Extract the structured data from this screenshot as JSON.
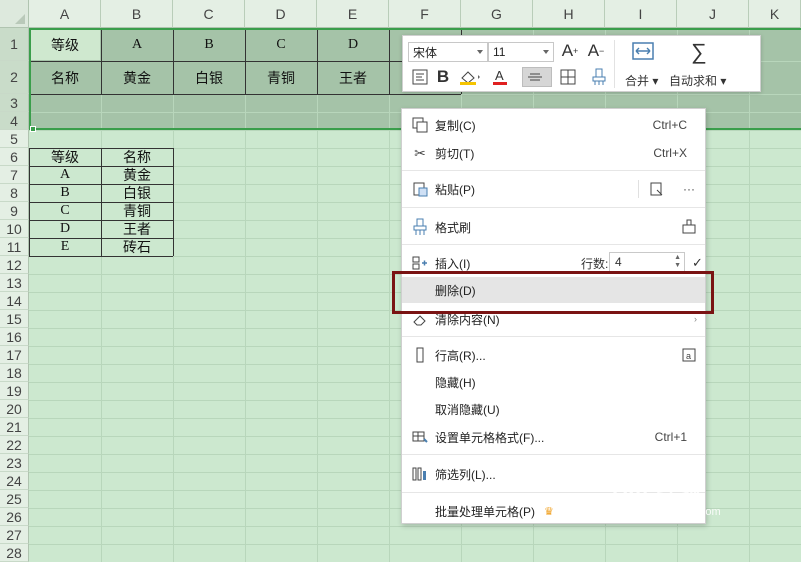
{
  "columns": [
    "A",
    "B",
    "C",
    "D",
    "E",
    "F",
    "G",
    "H",
    "I",
    "J",
    "K"
  ],
  "rows": [
    "1",
    "2",
    "3",
    "4",
    "5",
    "6",
    "7",
    "8",
    "9",
    "10",
    "11",
    "12",
    "13",
    "14",
    "15",
    "16",
    "17",
    "18",
    "19",
    "20",
    "21",
    "22",
    "23",
    "24",
    "25",
    "26",
    "27",
    "28"
  ],
  "top_table": {
    "row1": [
      "等级",
      "A",
      "B",
      "C",
      "D"
    ],
    "row2": [
      "名称",
      "黄金",
      "白银",
      "青铜",
      "王者"
    ]
  },
  "lower_table": {
    "header": [
      "等级",
      "名称"
    ],
    "rows": [
      [
        "A",
        "黄金"
      ],
      [
        "B",
        "白银"
      ],
      [
        "C",
        "青铜"
      ],
      [
        "D",
        "王者"
      ],
      [
        "E",
        "砖石"
      ]
    ]
  },
  "mini_toolbar": {
    "font_name": "宋体",
    "font_size": "11",
    "increase_font_icon": "A⁺",
    "decrease_font_icon": "A⁻",
    "bold": "B",
    "merge_label": "合并",
    "autosum_label": "自动求和"
  },
  "context_menu": {
    "copy": {
      "label": "复制(C)",
      "shortcut": "Ctrl+C"
    },
    "cut": {
      "label": "剪切(T)",
      "shortcut": "Ctrl+X"
    },
    "paste": {
      "label": "粘贴(P)",
      "more": "···"
    },
    "format_painter": {
      "label": "格式刷"
    },
    "insert": {
      "label": "插入(I)",
      "rows_label": "行数:",
      "rows_value": "4"
    },
    "delete": {
      "label": "删除(D)"
    },
    "clear": {
      "label": "清除内容(N)"
    },
    "row_height": {
      "label": "行高(R)..."
    },
    "hide": {
      "label": "隐藏(H)"
    },
    "unhide": {
      "label": "取消隐藏(U)"
    },
    "format_cells": {
      "label": "设置单元格格式(F)...",
      "shortcut": "Ctrl+1"
    },
    "filter_col": {
      "label": "筛选列(L)..."
    },
    "batch": {
      "label": "批量处理单元格(P)"
    }
  },
  "watermark": {
    "text": "Bai 经验",
    "url": "jingyan.baidu.com"
  },
  "colors": {
    "accent_green": "#3a9e4b",
    "highlight_box": "#7a1313",
    "sheet_bg": "#cce8cf"
  }
}
